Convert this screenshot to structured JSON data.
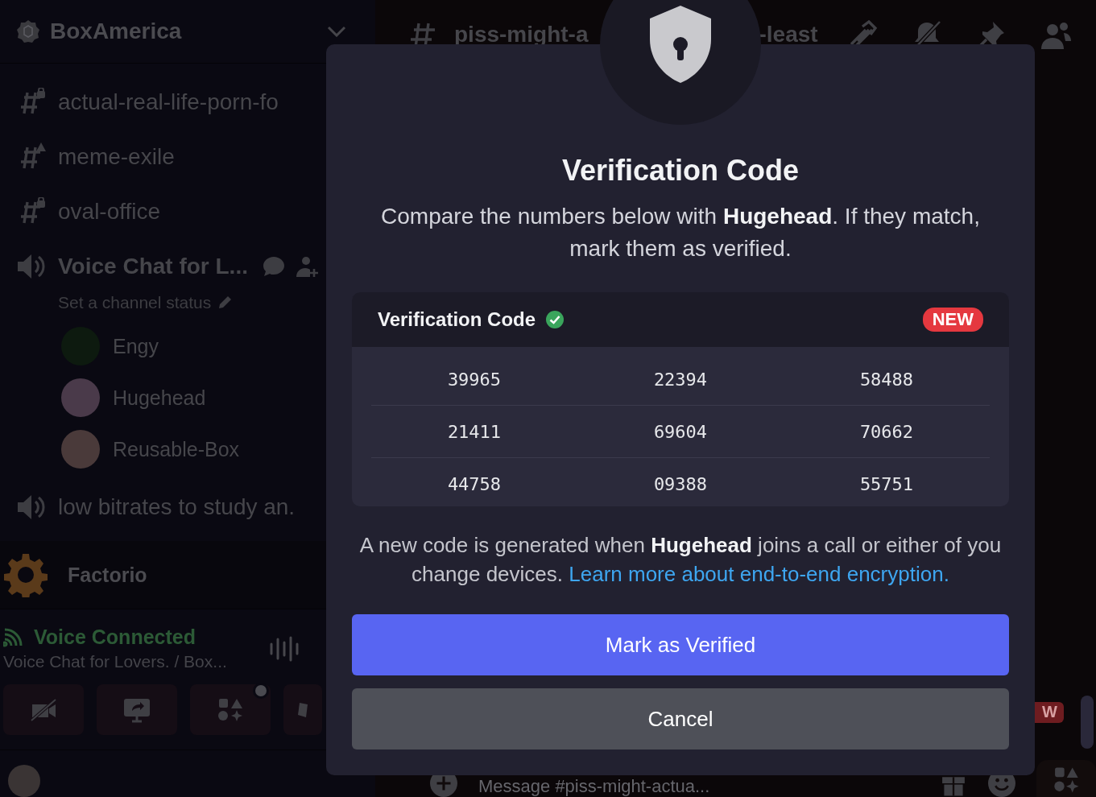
{
  "server": {
    "name": "BoxAmerica"
  },
  "channels": [
    {
      "kind": "locked",
      "name": "actual-real-life-porn-fo"
    },
    {
      "kind": "rules",
      "name": "meme-exile"
    },
    {
      "kind": "locked",
      "name": "oval-office"
    },
    {
      "kind": "voice",
      "name": "Voice Chat for L...",
      "status": "Set a channel status",
      "members": [
        {
          "name": "Engy"
        },
        {
          "name": "Hugehead"
        },
        {
          "name": "Reusable-Box"
        }
      ]
    },
    {
      "kind": "voice",
      "name": "low bitrates to study an."
    }
  ],
  "activity": {
    "name": "Factorio"
  },
  "voice_panel": {
    "status": "Voice Connected",
    "channel": "Voice Chat for Lovers. / Box..."
  },
  "header": {
    "title_parts": [
      "piss-might-a",
      "-least"
    ]
  },
  "composer": {
    "placeholder": "Message #piss-might-actua..."
  },
  "side_badge": "W",
  "modal": {
    "title": "Verification Code",
    "description": "Compare the numbers below with **Hugehead**. If they match, mark them as verified.",
    "card": {
      "title": "Verification Code",
      "verified": true,
      "badge": "NEW",
      "codes": [
        [
          "39965",
          "22394",
          "58488"
        ],
        [
          "21411",
          "69604",
          "70662"
        ],
        [
          "44758",
          "09388",
          "55751"
        ]
      ]
    },
    "note": "A new code is generated when **Hugehead** joins a call or either of you change devices.",
    "link": "Learn more about end-to-end encryption.",
    "buttons": [
      {
        "label": "Mark as Verified",
        "kind": "primary"
      },
      {
        "label": "Cancel",
        "kind": "secondary"
      }
    ]
  }
}
